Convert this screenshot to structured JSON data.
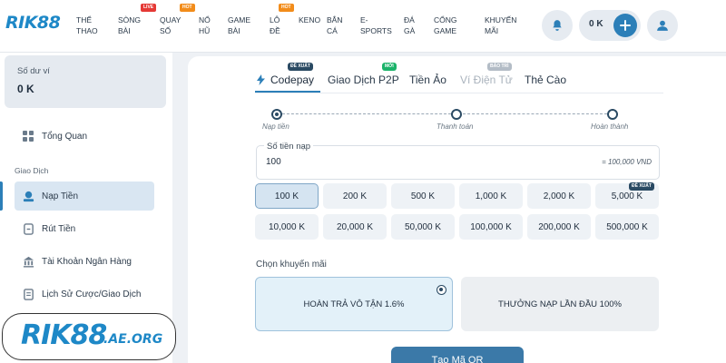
{
  "header": {
    "logo_text": "RIK88",
    "nav": [
      {
        "line1": "THỂ",
        "line2": "THAO",
        "badge": ""
      },
      {
        "line1": "SÒNG",
        "line2": "BÀI",
        "badge": "LIVE"
      },
      {
        "line1": "QUAY",
        "line2": "SỐ",
        "badge": "HOT"
      },
      {
        "line1": "NỔ",
        "line2": "HŨ",
        "badge": ""
      },
      {
        "line1": "GAME",
        "line2": "BÀI",
        "badge": ""
      },
      {
        "line1": "LÔ",
        "line2": "ĐỀ",
        "badge": "HOT"
      },
      {
        "line1": "KENO",
        "line2": "",
        "badge": ""
      },
      {
        "line1": "BẮN",
        "line2": "CÁ",
        "badge": ""
      },
      {
        "line1": "E-",
        "line2": "SPORTS",
        "badge": ""
      },
      {
        "line1": "ĐÁ",
        "line2": "GÀ",
        "badge": ""
      },
      {
        "line1": "CỔNG",
        "line2": "GAME",
        "badge": ""
      },
      {
        "line1": "KHUYẾN",
        "line2": "MÃI",
        "badge": ""
      }
    ],
    "balance": "0 K",
    "icons": [
      "bell-icon",
      "plus-icon",
      "user-icon"
    ]
  },
  "sidebar": {
    "wallet_label": "Số dư ví",
    "wallet_value": "0 K",
    "overview": "Tổng Quan",
    "group_label": "Giao Dịch",
    "items": [
      {
        "label": "Nạp Tiền",
        "icon": "deposit-icon",
        "active": true
      },
      {
        "label": "Rút Tiền",
        "icon": "withdraw-icon",
        "active": false
      },
      {
        "label": "Tài Khoản Ngân Hàng",
        "icon": "bank-icon",
        "active": false
      },
      {
        "label": "Lịch Sử Cược/Giao Dịch",
        "icon": "history-icon",
        "active": false
      }
    ],
    "brand_main": "RIK88",
    "brand_suffix": ".AE.ORG"
  },
  "tabs": [
    {
      "label": "Codepay",
      "badge": "ĐỀ XUẤT",
      "state": "active"
    },
    {
      "label": "Giao Dịch P2P",
      "badge": "MỚI",
      "state": "normal"
    },
    {
      "label": "Tiền Ảo",
      "badge": "",
      "state": "normal"
    },
    {
      "label": "Ví Điện Tử",
      "badge": "BẢO TRÌ",
      "state": "disabled"
    },
    {
      "label": "Thẻ Cào",
      "badge": "",
      "state": "normal"
    }
  ],
  "steps": [
    "Nạp tiền",
    "Thanh toán",
    "Hoàn thành"
  ],
  "amount": {
    "label": "Số tiền nạp",
    "value": "100",
    "hint": "= 100,000 VND"
  },
  "amount_chips": [
    "100 K",
    "200 K",
    "500 K",
    "1,000 K",
    "2,000 K",
    "5,000 K",
    "10,000 K",
    "20,000 K",
    "50,000 K",
    "100,000 K",
    "200,000 K",
    "500,000 K"
  ],
  "chip_badge": "ĐỀ XUẤT",
  "selected_chip": "100 K",
  "promo": {
    "label": "Chọn khuyến mãi",
    "options": [
      "HOÀN TRẢ VÔ TẬN 1.6%",
      "THƯỞNG NẠP LẦN ĐẦU 100%"
    ],
    "selected": "HOÀN TRẢ VÔ TẬN 1.6%"
  },
  "qr_button": "Tạo Mã QR",
  "colors": {
    "accent": "#2c7fb8",
    "brand": "#1e88c7",
    "badge_live": "#e53935",
    "badge_hot": "#f28c1a",
    "badge_new": "#1bb36a",
    "badge_recommend": "#2a4a63",
    "badge_maint": "#b3bcc6"
  }
}
